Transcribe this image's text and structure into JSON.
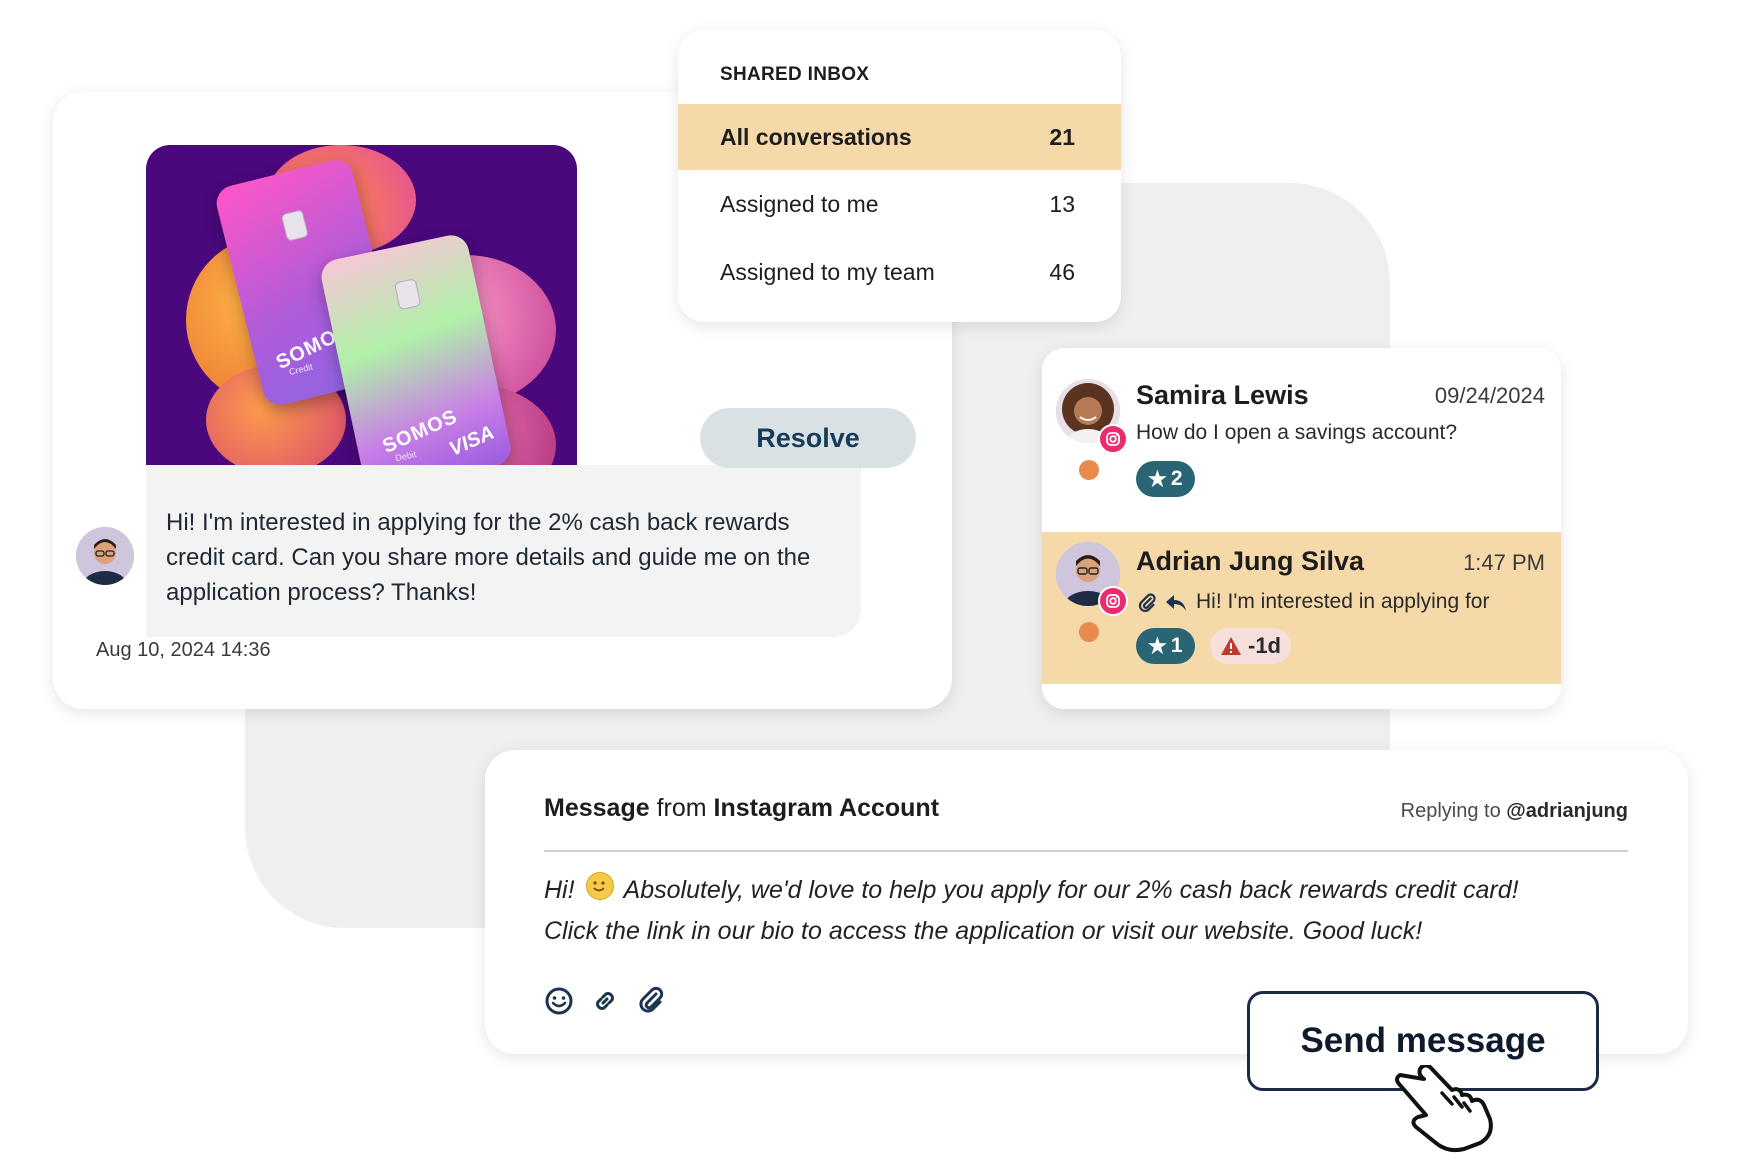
{
  "conversation": {
    "resolve_label": "Resolve",
    "message": "Hi! I'm interested in applying for the 2% cash back rewards credit card. Can you share more details and guide me on the application process? Thanks!",
    "timestamp": "Aug 10, 2024 14:36",
    "promo_card_front": {
      "brand": "SOMOS",
      "sub": "Debit",
      "network": "VISA"
    },
    "promo_card_back": {
      "brand": "SOMOS",
      "sub": "Credit"
    }
  },
  "inbox": {
    "title": "SHARED INBOX",
    "rows": [
      {
        "label": "All conversations",
        "count": "21"
      },
      {
        "label": "Assigned to me",
        "count": "13"
      },
      {
        "label": "Assigned to my team",
        "count": "46"
      }
    ]
  },
  "list": {
    "items": [
      {
        "name": "Samira Lewis",
        "date": "09/24/2024",
        "message": "How do I open a savings account?",
        "star_count": "2"
      },
      {
        "name": "Adrian Jung Silva",
        "date": "1:47 PM",
        "message": "Hi! I'm interested in applying for",
        "star_count": "1",
        "warning": "-1d"
      }
    ]
  },
  "reply": {
    "header_prefix": "Message",
    "header_mid": " from ",
    "header_account": "Instagram Account",
    "replying_prefix": "Replying to ",
    "replying_handle": "@adrianjung",
    "body_hi": "Hi!",
    "body_rest": "Absolutely, we'd love to help you apply for our 2% cash back rewards credit card!",
    "body_line2": "Click the link in our bio to access the application or visit our website. Good luck!",
    "send_label": "Send message"
  },
  "colors": {
    "accent_highlight": "#f5d9a8",
    "tag_teal": "#2a6576",
    "instagram_pink": "#ec2a6e",
    "status_orange": "#e98b4f",
    "promo_purple": "#4a087c"
  }
}
